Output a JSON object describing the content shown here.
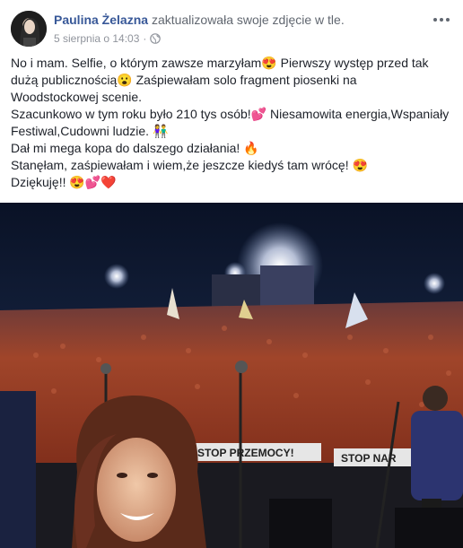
{
  "post": {
    "author": "Paulina Żelazna",
    "action": "zaktualizowała swoje zdjęcie w tle.",
    "timestamp": "5 sierpnia o 14:03",
    "separator": "·",
    "privacy_icon": "globe-icon",
    "more_icon": "more-options-icon",
    "text_lines": [
      "No i mam. Selfie, o którym zawsze marzyłam😍 Pierwszy występ przed tak",
      "dużą publicznością😮 Zaśpiewałam solo fragment piosenki na",
      "Woodstockowej scenie.",
      "Szacunkowo w tym roku było 210 tys osób!💕 Niesamowita energia,Wspaniały",
      "Festiwal,Cudowni ludzie. 👫",
      "Dał mi mega kopa do dalszego działania! 🔥",
      "Stanęłam, zaśpiewałam i wiem,że jeszcze kiedyś tam wrócę! 😍",
      "Dziękuję!! 😍💕❤️"
    ],
    "image": {
      "banner_left": "STOP PRZEMOCY!",
      "banner_right": "STOP NAR"
    }
  },
  "colors": {
    "author_link": "#385898",
    "meta_text": "#616770",
    "body_text": "#1d2129",
    "sky": "#0b1630",
    "crowd": "#7a2a14"
  }
}
